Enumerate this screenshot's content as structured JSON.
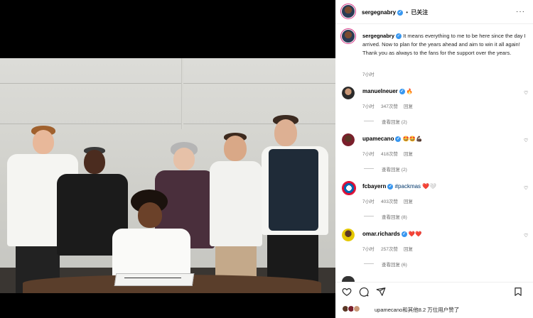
{
  "post": {
    "author": "sergegnabry",
    "separator": "•",
    "follow_state": "已关注",
    "caption_author": "sergegnabry",
    "caption_text": "It means everything to me to be here since the day I arrived. Now to plan for the years ahead and aim to win it all again! Thank you as always to the fans for the support over the years.",
    "caption_time": "7小时"
  },
  "comments": [
    {
      "user": "manuelneuer",
      "text": "🔥",
      "time": "7小时",
      "likes": "347次赞",
      "reply": "回复",
      "view_replies": "查看回复 (2)"
    },
    {
      "user": "upamecano",
      "text": "🤩🤩💪🏿",
      "time": "7小时",
      "likes": "418次赞",
      "reply": "回复",
      "view_replies": "查看回复 (2)"
    },
    {
      "user": "fcbayern",
      "text": "#packmas ❤️🤍",
      "time": "7小时",
      "likes": "403次赞",
      "reply": "回复",
      "view_replies": "查看回复 (8)"
    },
    {
      "user": "omar.richards",
      "text": "❤️❤️",
      "time": "7小时",
      "likes": "257次赞",
      "reply": "回复",
      "view_replies": "查看回复 (6)"
    }
  ],
  "likes_summary": "upamecano和其他8.2 万位用户赞了",
  "colors": {
    "verified": "#3897f0",
    "muted": "#737373",
    "ring": "#d63384"
  },
  "icons": [
    "more-icon",
    "heart-icon",
    "comment-icon",
    "share-icon",
    "bookmark-icon",
    "verified-icon"
  ]
}
